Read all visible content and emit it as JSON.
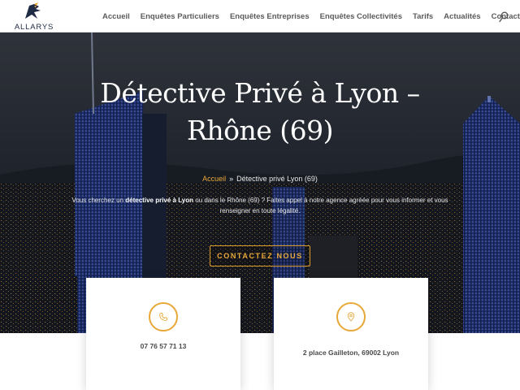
{
  "brand": {
    "name": "ALLARYS"
  },
  "nav": {
    "items": [
      {
        "label": "Accueil"
      },
      {
        "label": "Enquêtes Particuliers"
      },
      {
        "label": "Enquêtes Entreprises"
      },
      {
        "label": "Enquêtes Collectivités"
      },
      {
        "label": "Tarifs"
      },
      {
        "label": "Actualités"
      },
      {
        "label": "Contact"
      }
    ],
    "search_icon": "search-icon"
  },
  "hero": {
    "title_line1": "Détective Privé à Lyon –",
    "title_line2": "Rhône (69)",
    "breadcrumb": {
      "home": "Accueil",
      "separator": "»",
      "current": "Détective privé Lyon (69)"
    },
    "description": {
      "part1": "Vous cherchez un ",
      "bold1": "détective privé à Lyon",
      "part2": " ou dans le Rhône (69) ? Faites appel à notre agence agréée pour vous informer et vous renseigner en toute légalité."
    },
    "cta_label": "CONTACTEZ NOUS"
  },
  "cards": [
    {
      "icon": "phone-icon",
      "text": "07 76 57 71 13"
    },
    {
      "icon": "location-pin-icon",
      "text": "2 place Gailleton, 69002 Lyon"
    }
  ],
  "colors": {
    "accent": "#e8a838",
    "nav_text": "#5b5b5b",
    "brand_navy": "#1f2a44"
  }
}
